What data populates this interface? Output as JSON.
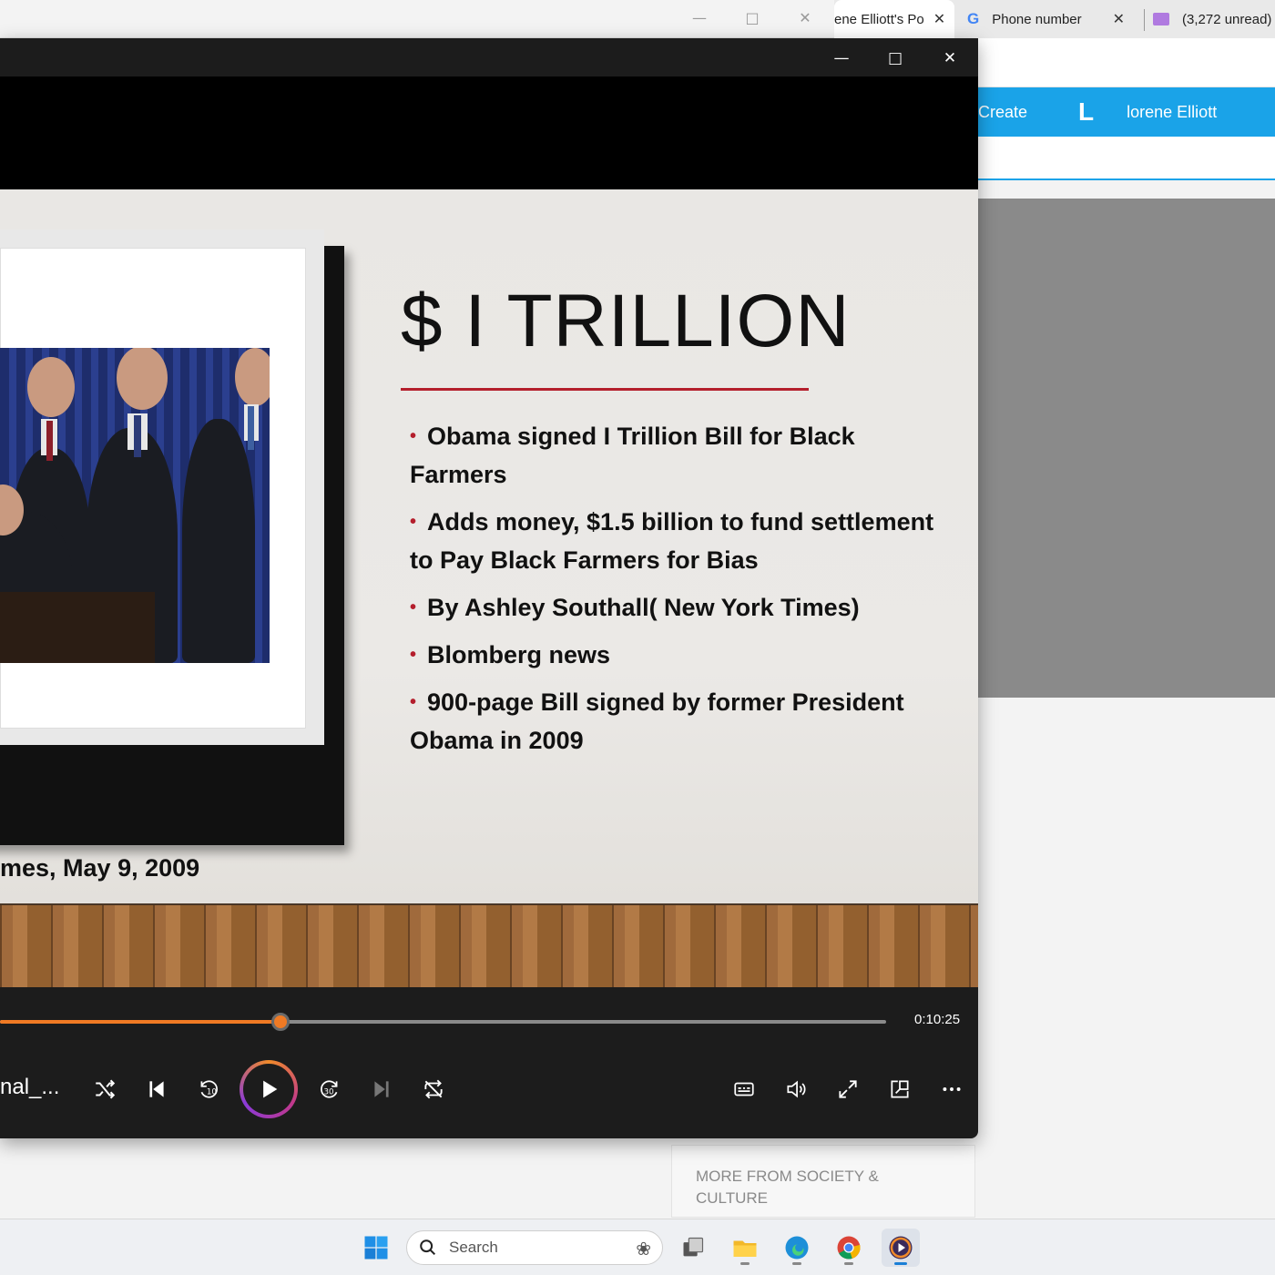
{
  "browser": {
    "tabs": [
      {
        "label": "ene Elliott's Po",
        "close": "✕"
      },
      {
        "label": "Phone number",
        "close": "✕"
      },
      {
        "label": "(3,272 unread)",
        "close": ""
      }
    ],
    "nav": {
      "create": "Create",
      "logo_letter": "L",
      "user": "lorene Elliott"
    },
    "more_box": "MORE FROM SOCIETY & CULTURE"
  },
  "slide": {
    "title": "$  I TRILLION",
    "bullets": [
      "Obama signed I Trillion Bill for Black Farmers",
      "Adds money, $1.5 billion to fund settlement to Pay Black Farmers for Bias",
      "By Ashley Southall( New York Times)",
      "Blomberg news",
      "900-page Bill signed by former President  Obama in 2009"
    ],
    "caption": "mes, May 9, 2009"
  },
  "player": {
    "duration": "0:10:25",
    "progress_fraction": 0.317,
    "media_name": "nal_...",
    "accent": "#f07a24"
  },
  "taskbar": {
    "search_placeholder": "Search"
  }
}
